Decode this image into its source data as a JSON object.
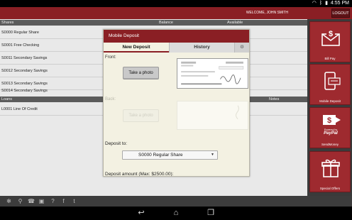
{
  "status_bar": {
    "time": "4:55 PM"
  },
  "header": {
    "welcome": "WELCOME, JOHN SMITH",
    "logout": "LOGOUT"
  },
  "shares": {
    "headers": [
      "Shares",
      "Balance",
      "Available"
    ],
    "rows": [
      "S0000 Regular Share",
      "S0001 Free Checking",
      "S0011 Secondary Savings",
      "S0012 Secondary Savings",
      "S0013 Secondary Savings",
      "S0014 Secondary Savings"
    ]
  },
  "loans": {
    "headers": [
      "Loans",
      "Notes"
    ],
    "rows": [
      "L0001 Line Of Credit"
    ]
  },
  "tiles": [
    {
      "label": "Bill Pay",
      "icon": "bill-pay-icon"
    },
    {
      "label": "Mobile Deposit",
      "icon": "mobile-deposit-icon"
    },
    {
      "label": "SendMoney",
      "icon": "paypal-icon",
      "brand": "PayPal",
      "brand_prefix": "Powered by"
    },
    {
      "label": "Special Offers",
      "icon": "gift-icon"
    }
  ],
  "modal": {
    "title": "Mobile Deposit",
    "tabs": {
      "new_deposit": "New Deposit",
      "history": "History"
    },
    "front_label": "Front:",
    "back_label": "Back:",
    "take_photo": "Take a photo",
    "deposit_to_label": "Deposit to:",
    "deposit_to_value": "S0000 Regular Share",
    "amount_label": "Deposit amount (Max: $2500.00):"
  },
  "colors": {
    "brand": "#8a1f24",
    "modal_bg": "#f3f1e2",
    "bar": "#3c3c3c"
  }
}
